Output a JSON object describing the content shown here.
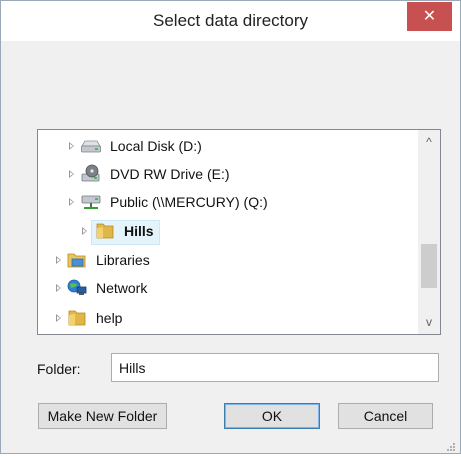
{
  "dialog": {
    "title": "Select data directory",
    "close_glyph": "✕"
  },
  "tree": {
    "items": [
      {
        "label": "Local Disk (D:)",
        "icon": "hard-drive-icon"
      },
      {
        "label": "DVD RW Drive (E:)",
        "icon": "dvd-drive-icon"
      },
      {
        "label": "Public (\\\\MERCURY) (Q:)",
        "icon": "network-drive-icon"
      },
      {
        "label": "Hills",
        "icon": "folder-icon",
        "selected": true
      },
      {
        "label": "Libraries",
        "icon": "libraries-icon"
      },
      {
        "label": "Network",
        "icon": "network-icon"
      },
      {
        "label": "help",
        "icon": "folder-icon"
      }
    ],
    "scroll_up_glyph": "^",
    "scroll_down_glyph": "v"
  },
  "folder": {
    "label": "Folder:",
    "value": "Hills"
  },
  "buttons": {
    "make_new_folder": "Make New Folder",
    "ok": "OK",
    "cancel": "Cancel"
  },
  "colors": {
    "close_button": "#c75050",
    "selection": "#e5f3fb"
  }
}
